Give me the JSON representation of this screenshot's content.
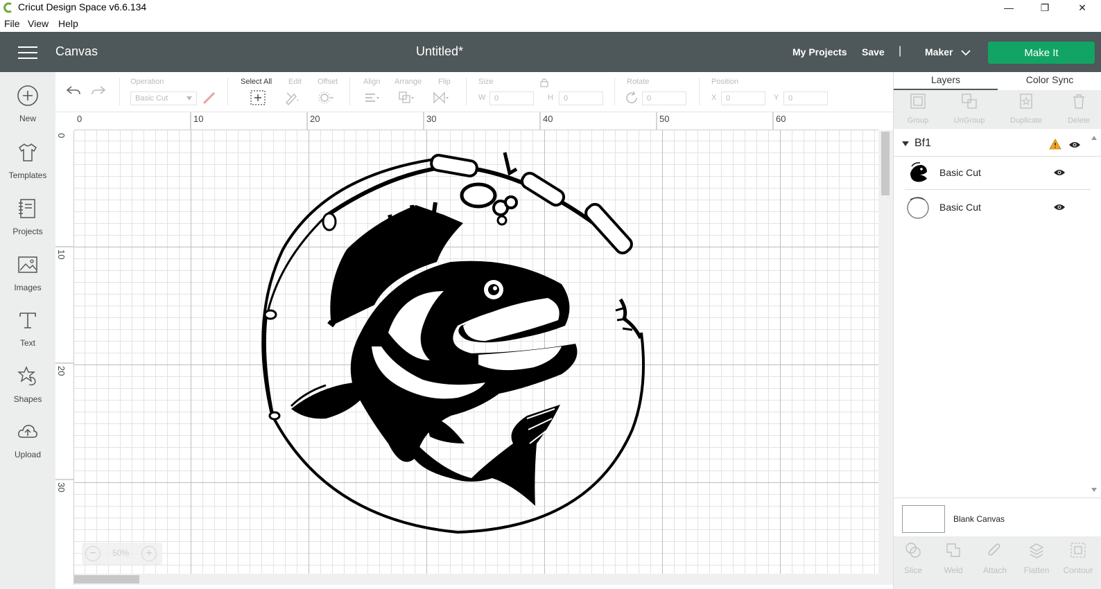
{
  "window": {
    "title": "Cricut Design Space  v6.6.134",
    "controls": {
      "minimize": "—",
      "restore": "❐",
      "close": "✕"
    }
  },
  "menubar": {
    "items": [
      "File",
      "View",
      "Help"
    ]
  },
  "header": {
    "section": "Canvas",
    "document_title": "Untitled*",
    "my_projects": "My Projects",
    "save": "Save",
    "separator": "|",
    "machine": "Maker",
    "make_it": "Make It"
  },
  "sidebar": {
    "items": [
      {
        "label": "New",
        "icon": "plus-circle-icon"
      },
      {
        "label": "Templates",
        "icon": "tshirt-icon"
      },
      {
        "label": "Projects",
        "icon": "notebook-icon"
      },
      {
        "label": "Images",
        "icon": "picture-icon"
      },
      {
        "label": "Text",
        "icon": "text-T-icon"
      },
      {
        "label": "Shapes",
        "icon": "shapes-icon"
      },
      {
        "label": "Upload",
        "icon": "cloud-upload-icon"
      }
    ]
  },
  "toolbar": {
    "operation_label": "Operation",
    "operation_value": "Basic Cut",
    "select_all": "Select All",
    "edit": "Edit",
    "offset": "Offset",
    "align": "Align",
    "arrange": "Arrange",
    "flip": "Flip",
    "size": "Size",
    "size_w_label": "W",
    "size_w": "0",
    "size_h_label": "H",
    "size_h": "0",
    "rotate": "Rotate",
    "rotate_value": "0",
    "position": "Position",
    "pos_x_label": "X",
    "pos_x": "0",
    "pos_y_label": "Y",
    "pos_y": "0"
  },
  "rulers": {
    "top": [
      "0",
      "10",
      "20",
      "30",
      "40",
      "50",
      "60"
    ],
    "left": [
      "0",
      "10",
      "20",
      "30"
    ]
  },
  "zoom": {
    "minus": "−",
    "value": "50%",
    "plus": "+"
  },
  "panel": {
    "tabs": [
      "Layers",
      "Color Sync"
    ],
    "actions": [
      "Group",
      "UnGroup",
      "Duplicate",
      "Delete"
    ],
    "group_name": "Bf1",
    "layers": [
      {
        "name": "Basic Cut",
        "thumb": "fish-thumbnail"
      },
      {
        "name": "Basic Cut",
        "thumb": "circle-rod-thumbnail"
      }
    ],
    "blank_canvas": "Blank Canvas",
    "bottom_actions": [
      "Slice",
      "Weld",
      "Attach",
      "Flatten",
      "Contour"
    ]
  },
  "colors": {
    "header_bg": "#4e5759",
    "make_it_green": "#11a464",
    "warning": "#f5a623"
  }
}
